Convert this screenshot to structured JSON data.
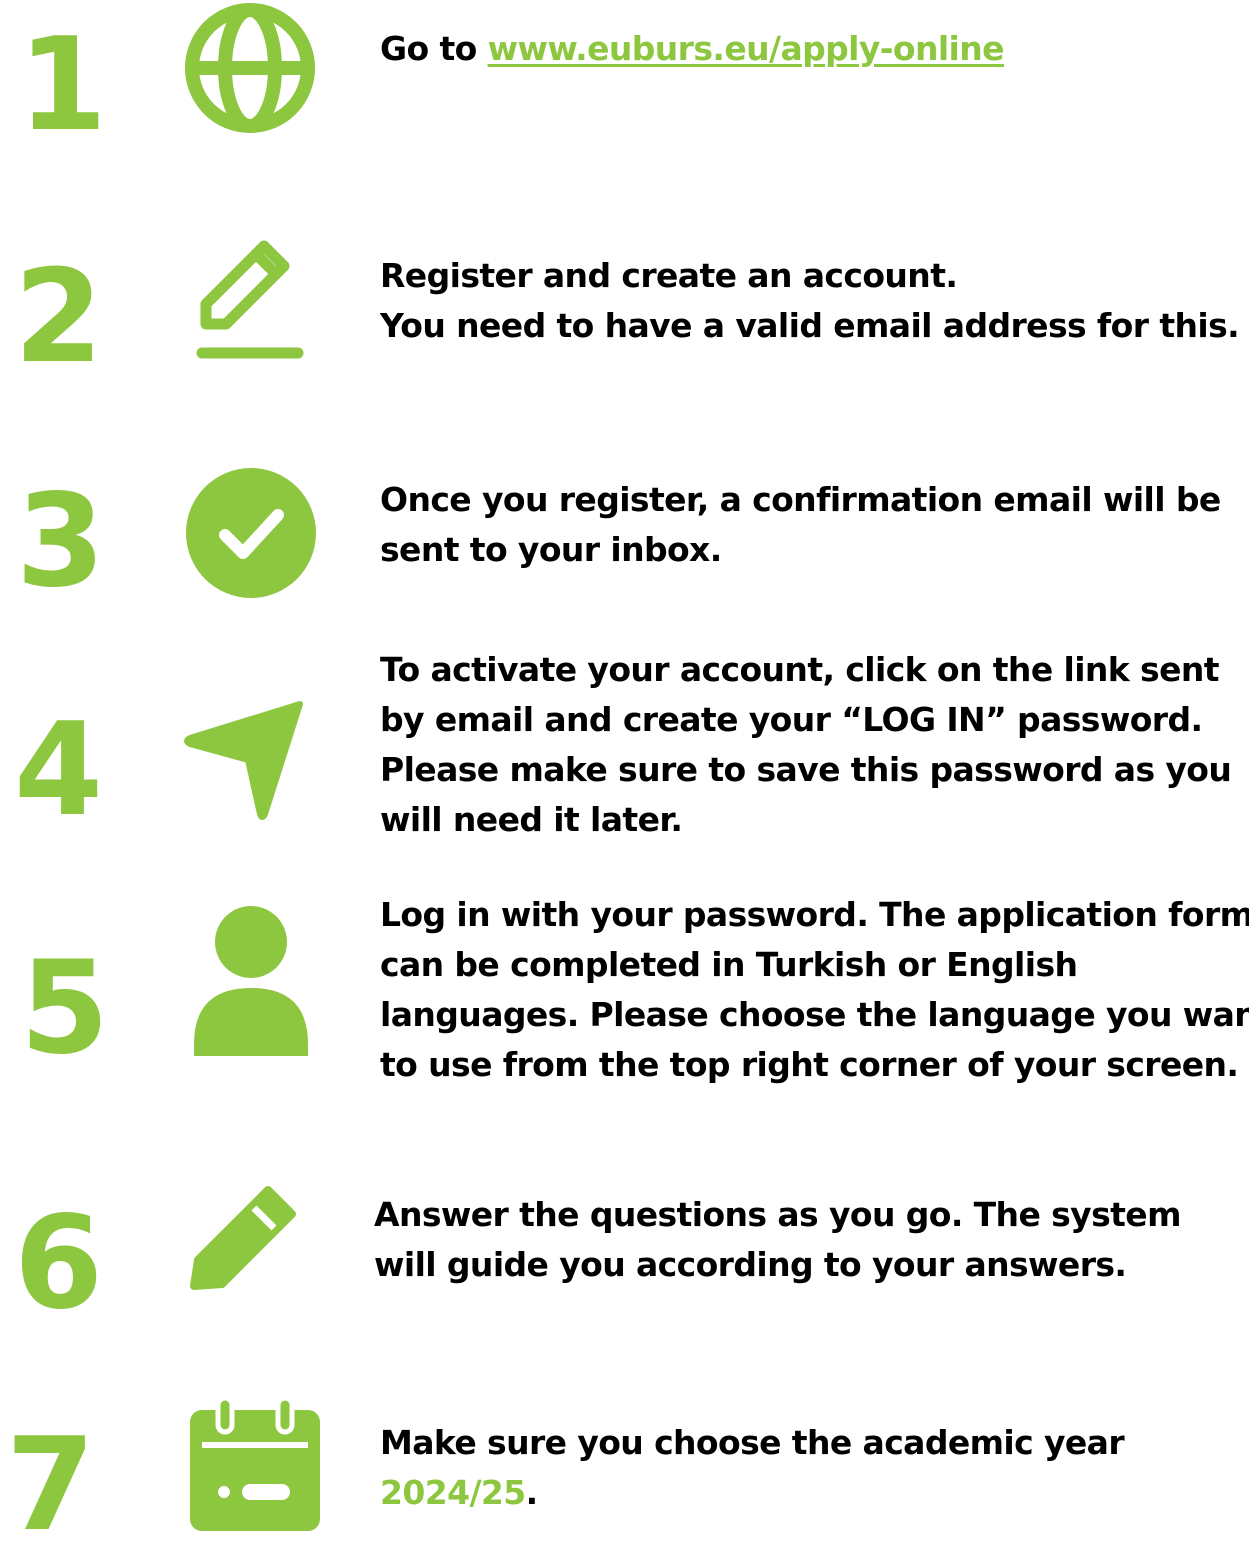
{
  "colors": {
    "accent": "#8dc63f",
    "text": "#000000",
    "background": "#ffffff"
  },
  "steps": [
    {
      "number": "1",
      "icon": "globe-icon",
      "prefix": "Go to ",
      "link": "www.euburs.eu/apply-online"
    },
    {
      "number": "2",
      "icon": "pencil-outline-icon",
      "lines": [
        "Register and create an account.",
        "You need to have a valid email address for this."
      ]
    },
    {
      "number": "3",
      "icon": "check-circle-icon",
      "lines": [
        "Once you register, a confirmation email will be",
        "sent to your inbox."
      ]
    },
    {
      "number": "4",
      "icon": "navigation-arrow-icon",
      "lines": [
        "To activate your account, click on the link sent",
        "by email and create your “LOG IN” password.",
        "Please make sure to save this password as you",
        "will need it later."
      ]
    },
    {
      "number": "5",
      "icon": "user-icon",
      "lines": [
        "Log in with your password. The application form",
        "can be completed in Turkish or English",
        "languages. Please choose the language you want",
        "to use from the top right corner of your screen."
      ]
    },
    {
      "number": "6",
      "icon": "pencil-filled-icon",
      "lines": [
        "Answer the questions as you go. The system",
        "will guide you according to your answers."
      ]
    },
    {
      "number": "7",
      "icon": "calendar-icon",
      "line1": "Make sure you choose the academic year",
      "year": "2024/25",
      "period": "."
    }
  ]
}
